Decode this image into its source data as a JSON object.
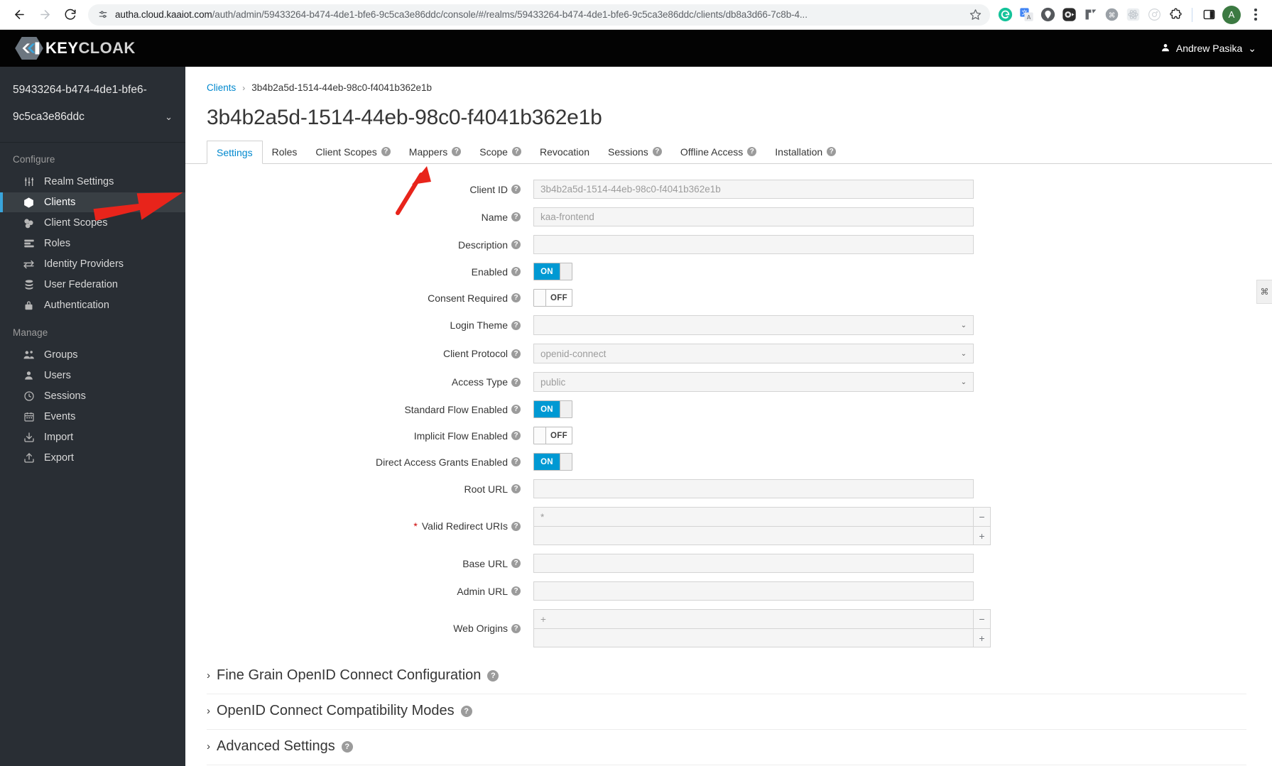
{
  "browser": {
    "back_label": "Back",
    "forward_label": "Forward",
    "reload_label": "Reload",
    "site_info_label": "View site information",
    "url_bold": "autha.cloud.kaaiot.com",
    "url_rest": "/auth/admin/59433264-b474-4de1-bfe6-9c5ca3e86ddc/console/#/realms/59433264-b474-4de1-bfe6-9c5ca3e86ddc/clients/db8a3d66-7c8b-4...",
    "bookmark_label": "Bookmark this tab",
    "extensions": [
      {
        "name": "grammarly-extension-icon",
        "glyph": "G",
        "color": "#15c39a"
      },
      {
        "name": "google-translate-extension-icon",
        "glyph": "文",
        "color": "#4285f4"
      },
      {
        "name": "location-pin-extension-icon",
        "glyph": "●",
        "color": "#6b6b6b"
      },
      {
        "name": "video-recorder-extension-icon",
        "glyph": "▶",
        "color": "#2b2b2b"
      },
      {
        "name": "arrow-corner-extension-icon",
        "glyph": "⌐",
        "color": "#5f6368"
      },
      {
        "name": "command-extension-icon",
        "glyph": "⌘",
        "color": "#9aa0a6"
      },
      {
        "name": "react-devtools-extension-icon",
        "glyph": "⚛",
        "color": "#c9ced3"
      },
      {
        "name": "target-extension-icon",
        "glyph": "◎",
        "color": "#d0d4d8"
      }
    ],
    "puzzle_label": "Extensions",
    "sidepanel_label": "Side panel",
    "profile_initial": "A",
    "menu_label": "Customize and control Chrome"
  },
  "masthead": {
    "brand_kc": "KEY",
    "brand_cloak": "CLOAK",
    "user_name": "Andrew Pasika",
    "user_caret": "⌄"
  },
  "sidebar": {
    "realm_line1": "59433264-b474-4de1-bfe6-",
    "realm_line2": "9c5ca3e86ddc",
    "realm_caret": "⌄",
    "sections": [
      {
        "title": "Configure",
        "items": [
          {
            "label": "Realm Settings",
            "icon": "sliders-icon",
            "active": false
          },
          {
            "label": "Clients",
            "icon": "cube-icon",
            "active": true
          },
          {
            "label": "Client Scopes",
            "icon": "blocks-icon",
            "active": false
          },
          {
            "label": "Roles",
            "icon": "list-icon",
            "active": false
          },
          {
            "label": "Identity Providers",
            "icon": "exchange-icon",
            "active": false
          },
          {
            "label": "User Federation",
            "icon": "database-icon",
            "active": false
          },
          {
            "label": "Authentication",
            "icon": "lock-icon",
            "active": false
          }
        ]
      },
      {
        "title": "Manage",
        "items": [
          {
            "label": "Groups",
            "icon": "users-icon",
            "active": false
          },
          {
            "label": "Users",
            "icon": "user-icon",
            "active": false
          },
          {
            "label": "Sessions",
            "icon": "clock-icon",
            "active": false
          },
          {
            "label": "Events",
            "icon": "calendar-icon",
            "active": false
          },
          {
            "label": "Import",
            "icon": "import-icon",
            "active": false
          },
          {
            "label": "Export",
            "icon": "export-icon",
            "active": false
          }
        ]
      }
    ]
  },
  "main": {
    "breadcrumb": {
      "root": "Clients",
      "separator": "›",
      "current": "3b4b2a5d-1514-44eb-98c0-f4041b362e1b"
    },
    "page_title": "3b4b2a5d-1514-44eb-98c0-f4041b362e1b",
    "tabs": [
      {
        "label": "Settings",
        "help": false,
        "active": true
      },
      {
        "label": "Roles",
        "help": false,
        "active": false
      },
      {
        "label": "Client Scopes",
        "help": true,
        "active": false
      },
      {
        "label": "Mappers",
        "help": true,
        "active": false
      },
      {
        "label": "Scope",
        "help": true,
        "active": false
      },
      {
        "label": "Revocation",
        "help": false,
        "active": false
      },
      {
        "label": "Sessions",
        "help": true,
        "active": false
      },
      {
        "label": "Offline Access",
        "help": true,
        "active": false
      },
      {
        "label": "Installation",
        "help": true,
        "active": false
      }
    ],
    "help_glyph": "?",
    "fields": [
      {
        "kind": "text",
        "label": "Client ID",
        "value": "3b4b2a5d-1514-44eb-98c0-f4041b362e1b",
        "required": false,
        "help": true
      },
      {
        "kind": "text",
        "label": "Name",
        "value": "kaa-frontend",
        "required": false,
        "help": true
      },
      {
        "kind": "text",
        "label": "Description",
        "value": "",
        "required": false,
        "help": true
      },
      {
        "kind": "toggle",
        "label": "Enabled",
        "value": "ON",
        "required": false,
        "help": true
      },
      {
        "kind": "toggle",
        "label": "Consent Required",
        "value": "OFF",
        "required": false,
        "help": true
      },
      {
        "kind": "select",
        "label": "Login Theme",
        "value": "",
        "required": false,
        "help": true
      },
      {
        "kind": "select",
        "label": "Client Protocol",
        "value": "openid-connect",
        "required": false,
        "help": true
      },
      {
        "kind": "select",
        "label": "Access Type",
        "value": "public",
        "required": false,
        "help": true
      },
      {
        "kind": "toggle",
        "label": "Standard Flow Enabled",
        "value": "ON",
        "required": false,
        "help": true
      },
      {
        "kind": "toggle",
        "label": "Implicit Flow Enabled",
        "value": "OFF",
        "required": false,
        "help": true
      },
      {
        "kind": "toggle",
        "label": "Direct Access Grants Enabled",
        "value": "ON",
        "required": false,
        "help": true
      },
      {
        "kind": "text",
        "label": "Root URL",
        "value": "",
        "required": false,
        "help": true
      },
      {
        "kind": "multi",
        "label": "Valid Redirect URIs",
        "values": [
          "*",
          ""
        ],
        "required": true,
        "help": true,
        "remove_glyph": "−",
        "add_glyph": "+"
      },
      {
        "kind": "text",
        "label": "Base URL",
        "value": "",
        "required": false,
        "help": true
      },
      {
        "kind": "text",
        "label": "Admin URL",
        "value": "",
        "required": false,
        "help": true
      },
      {
        "kind": "multi",
        "label": "Web Origins",
        "values": [
          "+",
          ""
        ],
        "required": false,
        "help": true,
        "remove_glyph": "−",
        "add_glyph": "+"
      }
    ],
    "accordions": [
      {
        "label": "Fine Grain OpenID Connect Configuration",
        "caret": "›",
        "help": true
      },
      {
        "label": "OpenID Connect Compatibility Modes",
        "caret": "›",
        "help": true
      },
      {
        "label": "Advanced Settings",
        "caret": "›",
        "help": true
      }
    ],
    "edge_widget_glyph": "⌘"
  },
  "annotations": {
    "arrow_to_clients": "red arrow pointing at Clients sidebar item",
    "arrow_to_client_id": "red arrow pointing at Client ID field",
    "arrow_color": "#e8241b"
  },
  "colors": {
    "accent": "#0088ce",
    "toggle_on": "#0099d3",
    "sidebar_bg": "#292e34",
    "masthead_bg": "#030303",
    "active_item_bg": "#393f44",
    "active_border": "#39a5dc"
  }
}
